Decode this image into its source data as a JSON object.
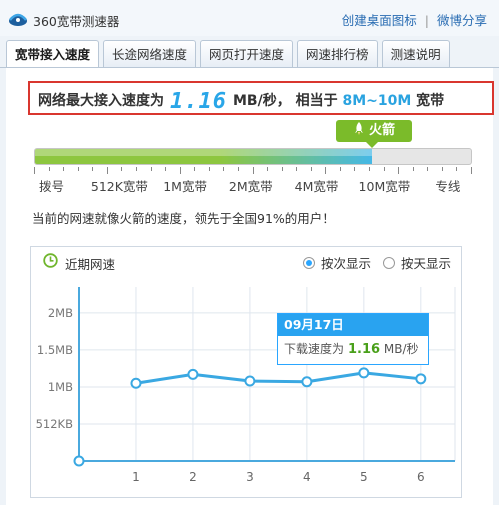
{
  "app": {
    "title": "360宽带测速器"
  },
  "title_links": {
    "desktop_icon": "创建桌面图标",
    "separator": "|",
    "weibo_share": "微博分享"
  },
  "tabs": [
    {
      "label": "宽带接入速度",
      "active": true
    },
    {
      "label": "长途网络速度",
      "active": false
    },
    {
      "label": "网页打开速度",
      "active": false
    },
    {
      "label": "网速排行榜",
      "active": false
    },
    {
      "label": "测速说明",
      "active": false
    }
  ],
  "speed": {
    "prefix": "网络最大接入速度为",
    "value": "1.16",
    "unit": "MB/秒，",
    "equiv_prefix": "相当于",
    "equiv_value": "8M~10M",
    "equiv_suffix": "宽带"
  },
  "level": {
    "badge": "火箭",
    "fill_fraction": 0.774
  },
  "tick_labels": [
    {
      "label": "拨号",
      "pos": 0.04
    },
    {
      "label": "512K宽带",
      "pos": 0.195
    },
    {
      "label": "1M宽带",
      "pos": 0.345
    },
    {
      "label": "2M宽带",
      "pos": 0.495
    },
    {
      "label": "4M宽带",
      "pos": 0.645
    },
    {
      "label": "10M宽带",
      "pos": 0.8
    },
    {
      "label": "专线",
      "pos": 0.945
    }
  ],
  "rank_text": "当前的网速就像火箭的速度，领先于全国91%的用户！",
  "chart_panel": {
    "title": "近期网速",
    "radio_by_count": "按次显示",
    "radio_by_day": "按天显示",
    "by_count_selected": true
  },
  "tooltip": {
    "date": "09月17日",
    "label": "下载速度为",
    "value": "1.16",
    "unit": "MB/秒"
  },
  "chart_data": {
    "type": "line",
    "x": [
      0,
      1,
      2,
      3,
      4,
      5,
      6
    ],
    "x_tick_labels": [
      "1",
      "2",
      "3",
      "4",
      "5",
      "6"
    ],
    "y_tick_labels": [
      "2MB",
      "1.5MB",
      "1MB",
      "512KB"
    ],
    "y_ticks_mb": [
      2,
      1.5,
      1,
      0.5
    ],
    "series": [
      {
        "values": [
          0,
          1.05,
          1.17,
          1.08,
          1.07,
          1.19,
          1.11
        ]
      }
    ],
    "ylim": [
      0,
      2.35
    ],
    "xlim": [
      0,
      6.6
    ],
    "grid": true,
    "line_color": "#3aa8e2"
  }
}
